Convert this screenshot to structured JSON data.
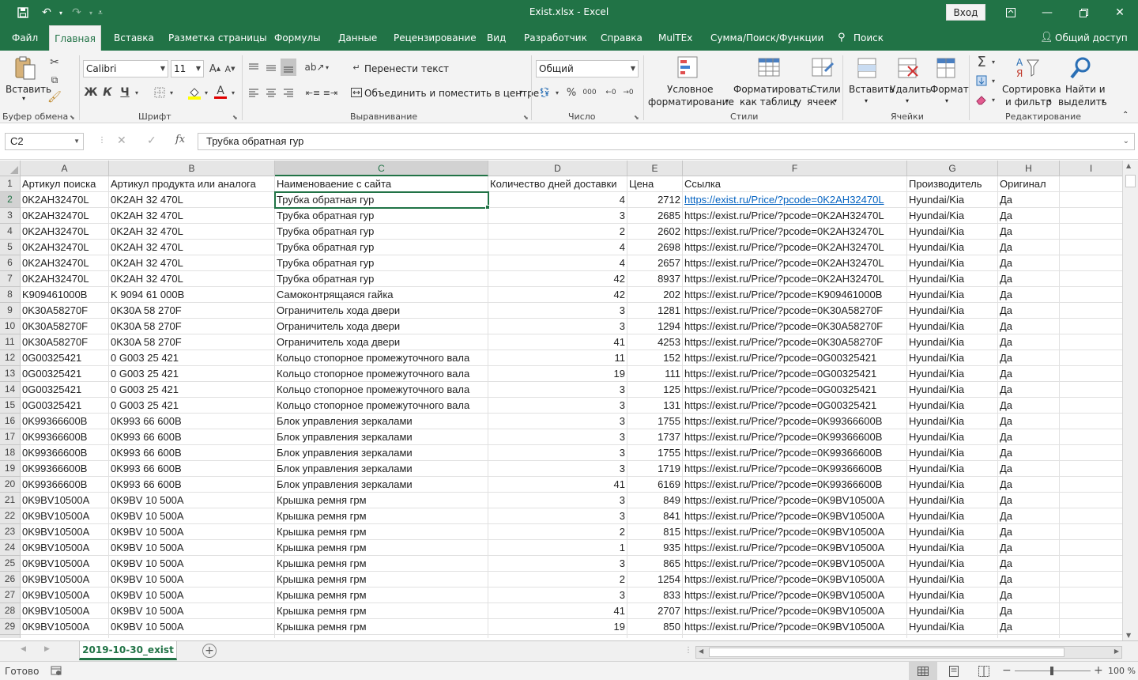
{
  "window": {
    "title": "Exist.xlsx  -  Excel",
    "signin_label": "Вход"
  },
  "ribbon_tabs": [
    {
      "label": "Файл",
      "active": false
    },
    {
      "label": "Главная",
      "active": true
    },
    {
      "label": "Вставка",
      "active": false
    },
    {
      "label": "Разметка страницы",
      "active": false
    },
    {
      "label": "Формулы",
      "active": false
    },
    {
      "label": "Данные",
      "active": false
    },
    {
      "label": "Рецензирование",
      "active": false
    },
    {
      "label": "Вид",
      "active": false
    },
    {
      "label": "Разработчик",
      "active": false
    },
    {
      "label": "Справка",
      "active": false
    },
    {
      "label": "MulTEx",
      "active": false
    },
    {
      "label": "Сумма/Поиск/Функции",
      "active": false
    },
    {
      "label": "Поиск",
      "active": false
    }
  ],
  "share_label": "Общий доступ",
  "ribbon": {
    "paste_label": "Вставить",
    "clipboard_group": "Буфер обмена",
    "font_name": "Calibri",
    "font_size": "11",
    "bold": "Ж",
    "italic": "К",
    "underline": "Ч",
    "font_group": "Шрифт",
    "wrap_text": "Перенести текст",
    "merge_center": "Объединить и поместить в центре",
    "alignment_group": "Выравнивание",
    "number_format": "Общий",
    "number_group": "Число",
    "cond_format_1": "Условное",
    "cond_format_2": "форматирование",
    "format_table_1": "Форматировать",
    "format_table_2": "как таблицу",
    "cell_styles_1": "Стили",
    "cell_styles_2": "ячеек",
    "styles_group": "Стили",
    "insert_label": "Вставить",
    "delete_label": "Удалить",
    "format_label": "Формат",
    "cells_group": "Ячейки",
    "sort_filter_1": "Сортировка",
    "sort_filter_2": "и фильтр",
    "find_select_1": "Найти и",
    "find_select_2": "выделить",
    "editing_group": "Редактирование"
  },
  "formula_bar": {
    "name_box": "C2",
    "formula": "Трубка обратная гур"
  },
  "columns": [
    "A",
    "B",
    "C",
    "D",
    "E",
    "F",
    "G",
    "H",
    "I"
  ],
  "headers": [
    "Артикул поиска",
    "Артикул продукта или аналога",
    "Наименоваение с сайта",
    "Количество дней доставки",
    "Цена",
    "Ссылка",
    "Производитель",
    "Оригинал"
  ],
  "rows": [
    [
      "0K2AH32470L",
      "0K2AH 32 470L",
      "Трубка обратная гур",
      "4",
      "2712",
      "https://exist.ru/Price/?pcode=0K2AH32470L",
      "Hyundai/Kia",
      "Да"
    ],
    [
      "0K2AH32470L",
      "0K2AH 32 470L",
      "Трубка обратная гур",
      "3",
      "2685",
      "https://exist.ru/Price/?pcode=0K2AH32470L",
      "Hyundai/Kia",
      "Да"
    ],
    [
      "0K2AH32470L",
      "0K2AH 32 470L",
      "Трубка обратная гур",
      "2",
      "2602",
      "https://exist.ru/Price/?pcode=0K2AH32470L",
      "Hyundai/Kia",
      "Да"
    ],
    [
      "0K2AH32470L",
      "0K2AH 32 470L",
      "Трубка обратная гур",
      "4",
      "2698",
      "https://exist.ru/Price/?pcode=0K2AH32470L",
      "Hyundai/Kia",
      "Да"
    ],
    [
      "0K2AH32470L",
      "0K2AH 32 470L",
      "Трубка обратная гур",
      "4",
      "2657",
      "https://exist.ru/Price/?pcode=0K2AH32470L",
      "Hyundai/Kia",
      "Да"
    ],
    [
      "0K2AH32470L",
      "0K2AH 32 470L",
      "Трубка обратная гур",
      "42",
      "8937",
      "https://exist.ru/Price/?pcode=0K2AH32470L",
      "Hyundai/Kia",
      "Да"
    ],
    [
      "K909461000B",
      "K 9094 61 000B",
      "Самоконтрящаяся гайка",
      "42",
      "202",
      "https://exist.ru/Price/?pcode=K909461000B",
      "Hyundai/Kia",
      "Да"
    ],
    [
      "0K30A58270F",
      "0K30A 58 270F",
      "Ограничитель хода двери",
      "3",
      "1281",
      "https://exist.ru/Price/?pcode=0K30A58270F",
      "Hyundai/Kia",
      "Да"
    ],
    [
      "0K30A58270F",
      "0K30A 58 270F",
      "Ограничитель хода двери",
      "3",
      "1294",
      "https://exist.ru/Price/?pcode=0K30A58270F",
      "Hyundai/Kia",
      "Да"
    ],
    [
      "0K30A58270F",
      "0K30A 58 270F",
      "Ограничитель хода двери",
      "41",
      "4253",
      "https://exist.ru/Price/?pcode=0K30A58270F",
      "Hyundai/Kia",
      "Да"
    ],
    [
      "0G00325421",
      "0 G003 25 421",
      "Кольцо стопорное промежуточного вала",
      "11",
      "152",
      "https://exist.ru/Price/?pcode=0G00325421",
      "Hyundai/Kia",
      "Да"
    ],
    [
      "0G00325421",
      "0 G003 25 421",
      "Кольцо стопорное промежуточного вала",
      "19",
      "111",
      "https://exist.ru/Price/?pcode=0G00325421",
      "Hyundai/Kia",
      "Да"
    ],
    [
      "0G00325421",
      "0 G003 25 421",
      "Кольцо стопорное промежуточного вала",
      "3",
      "125",
      "https://exist.ru/Price/?pcode=0G00325421",
      "Hyundai/Kia",
      "Да"
    ],
    [
      "0G00325421",
      "0 G003 25 421",
      "Кольцо стопорное промежуточного вала",
      "3",
      "131",
      "https://exist.ru/Price/?pcode=0G00325421",
      "Hyundai/Kia",
      "Да"
    ],
    [
      "0K99366600B",
      "0K993 66 600B",
      "Блок управления зеркалами",
      "3",
      "1755",
      "https://exist.ru/Price/?pcode=0K99366600B",
      "Hyundai/Kia",
      "Да"
    ],
    [
      "0K99366600B",
      "0K993 66 600B",
      "Блок управления зеркалами",
      "3",
      "1737",
      "https://exist.ru/Price/?pcode=0K99366600B",
      "Hyundai/Kia",
      "Да"
    ],
    [
      "0K99366600B",
      "0K993 66 600B",
      "Блок управления зеркалами",
      "3",
      "1755",
      "https://exist.ru/Price/?pcode=0K99366600B",
      "Hyundai/Kia",
      "Да"
    ],
    [
      "0K99366600B",
      "0K993 66 600B",
      "Блок управления зеркалами",
      "3",
      "1719",
      "https://exist.ru/Price/?pcode=0K99366600B",
      "Hyundai/Kia",
      "Да"
    ],
    [
      "0K99366600B",
      "0K993 66 600B",
      "Блок управления зеркалами",
      "41",
      "6169",
      "https://exist.ru/Price/?pcode=0K99366600B",
      "Hyundai/Kia",
      "Да"
    ],
    [
      "0K9BV10500A",
      "0K9BV 10 500A",
      "Крышка ремня грм",
      "3",
      "849",
      "https://exist.ru/Price/?pcode=0K9BV10500A",
      "Hyundai/Kia",
      "Да"
    ],
    [
      "0K9BV10500A",
      "0K9BV 10 500A",
      "Крышка ремня грм",
      "3",
      "841",
      "https://exist.ru/Price/?pcode=0K9BV10500A",
      "Hyundai/Kia",
      "Да"
    ],
    [
      "0K9BV10500A",
      "0K9BV 10 500A",
      "Крышка ремня грм",
      "2",
      "815",
      "https://exist.ru/Price/?pcode=0K9BV10500A",
      "Hyundai/Kia",
      "Да"
    ],
    [
      "0K9BV10500A",
      "0K9BV 10 500A",
      "Крышка ремня грм",
      "1",
      "935",
      "https://exist.ru/Price/?pcode=0K9BV10500A",
      "Hyundai/Kia",
      "Да"
    ],
    [
      "0K9BV10500A",
      "0K9BV 10 500A",
      "Крышка ремня грм",
      "3",
      "865",
      "https://exist.ru/Price/?pcode=0K9BV10500A",
      "Hyundai/Kia",
      "Да"
    ],
    [
      "0K9BV10500A",
      "0K9BV 10 500A",
      "Крышка ремня грм",
      "2",
      "1254",
      "https://exist.ru/Price/?pcode=0K9BV10500A",
      "Hyundai/Kia",
      "Да"
    ],
    [
      "0K9BV10500A",
      "0K9BV 10 500A",
      "Крышка ремня грм",
      "3",
      "833",
      "https://exist.ru/Price/?pcode=0K9BV10500A",
      "Hyundai/Kia",
      "Да"
    ],
    [
      "0K9BV10500A",
      "0K9BV 10 500A",
      "Крышка ремня грм",
      "41",
      "2707",
      "https://exist.ru/Price/?pcode=0K9BV10500A",
      "Hyundai/Kia",
      "Да"
    ],
    [
      "0K9BV10500A",
      "0K9BV 10 500A",
      "Крышка ремня грм",
      "19",
      "850",
      "https://exist.ru/Price/?pcode=0K9BV10500A",
      "Hyundai/Kia",
      "Да"
    ]
  ],
  "selected_cell": {
    "col": "C",
    "row": 2
  },
  "sheet_tab": "2019-10-30_exist",
  "status": {
    "ready": "Готово",
    "zoom": "100 %"
  },
  "colors": {
    "accent": "#217346",
    "link": "#0563c1"
  }
}
